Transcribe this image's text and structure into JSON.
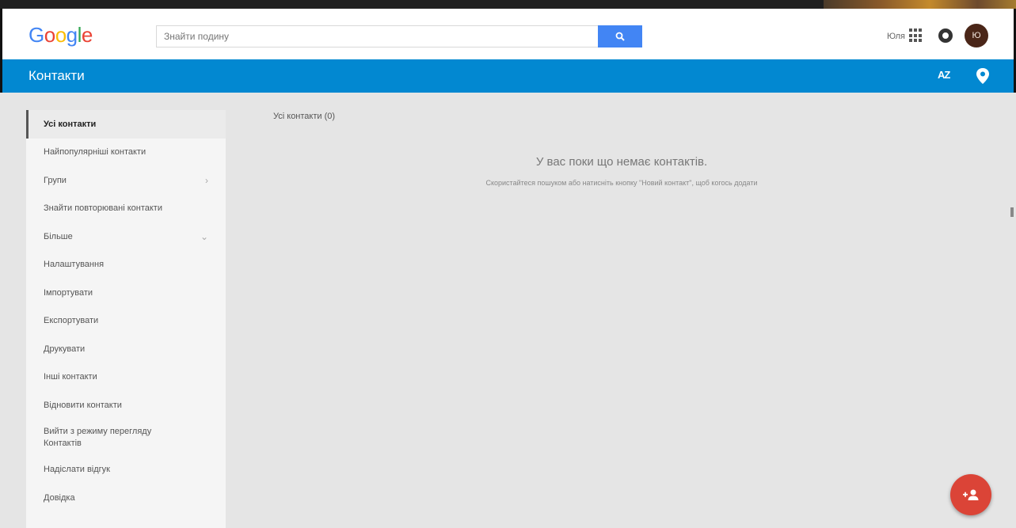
{
  "header": {
    "logo": [
      "G",
      "o",
      "o",
      "g",
      "l",
      "e"
    ],
    "logo_colors": [
      "#4285f4",
      "#ea4335",
      "#fbbc05",
      "#4285f4",
      "#34a853",
      "#ea4335"
    ],
    "search_placeholder": "Знайти подину",
    "search_icon": "search-icon",
    "user_name": "Юля",
    "apps_icon": "apps-grid-icon",
    "notifications_icon": "notifications-icon",
    "avatar_initials": "Ю"
  },
  "titlebar": {
    "title": "Контакти",
    "sort_label": "AZ",
    "pin_icon": "location-pin-icon",
    "color": "#0288d1"
  },
  "sidebar": {
    "items": [
      {
        "label": "Усі контакти"
      },
      {
        "label": "Найпопулярніші контакти"
      },
      {
        "label": "Групи",
        "chevron": "›"
      },
      {
        "label": "Знайти повторювані контакти"
      },
      {
        "label": "Більше",
        "chevron": "⌄"
      },
      {
        "label": "Налаштування"
      },
      {
        "label": "Імпортувати"
      },
      {
        "label": "Експортувати"
      },
      {
        "label": "Друкувати"
      },
      {
        "label": "Інші контакти"
      },
      {
        "label": "Відновити контакти"
      },
      {
        "label": "Вийти з режиму перегляду Контактів"
      },
      {
        "label": "Надіслати відгук"
      },
      {
        "label": "Довідка"
      }
    ]
  },
  "main": {
    "count_label": "Усі контакти (0)",
    "empty_title": "У вас поки що немає контактів.",
    "empty_subtitle": "Скористайтеся пошуком або натисніть кнопку \"Новий контакт\", щоб когось додати"
  },
  "fab": {
    "icon": "add-person-icon",
    "color": "#db4437"
  }
}
